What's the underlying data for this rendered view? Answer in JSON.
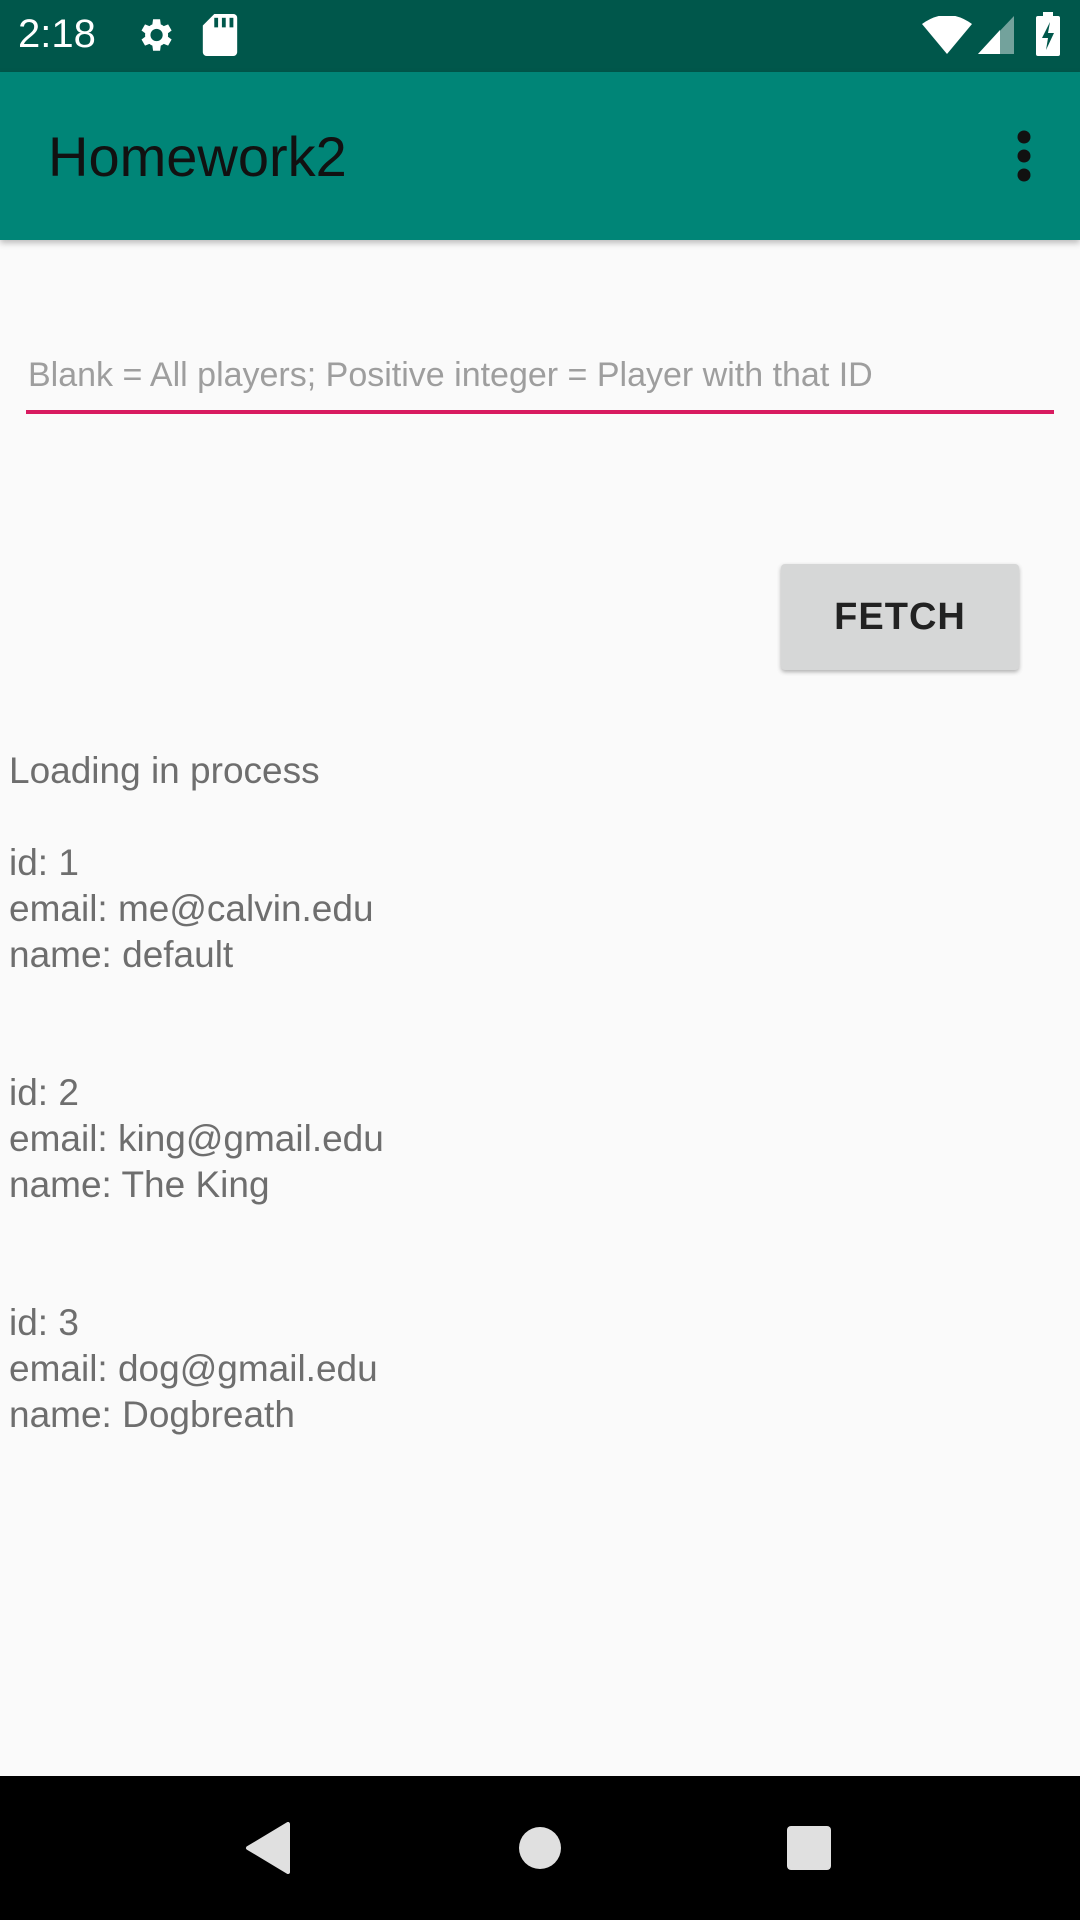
{
  "status_bar": {
    "time": "2:18",
    "left_icons": [
      "gear-icon",
      "sd-card-icon"
    ],
    "right_icons": [
      "wifi-icon",
      "signal-icon",
      "battery-charging-icon"
    ]
  },
  "app_bar": {
    "title": "Homework2",
    "menu_icon": "overflow-menu-icon"
  },
  "form": {
    "input_value": "",
    "input_placeholder": "Blank = All players; Positive integer = Player with that ID",
    "fetch_label": "FETCH"
  },
  "output": {
    "status_text": "Loading in process",
    "players": [
      {
        "id": "id: 1",
        "email": "email: me@calvin.edu",
        "name": "name: default"
      },
      {
        "id": "id: 2",
        "email": "email: king@gmail.edu",
        "name": "name: The King"
      },
      {
        "id": "id: 3",
        "email": "email: dog@gmail.edu",
        "name": "name: Dogbreath"
      }
    ]
  },
  "nav_bar": {
    "icons": [
      "back-icon",
      "home-icon",
      "recents-icon"
    ]
  },
  "colors": {
    "status_bar": "#00574b",
    "app_bar": "#008577",
    "accent": "#d81b60",
    "background": "#fafafa"
  }
}
